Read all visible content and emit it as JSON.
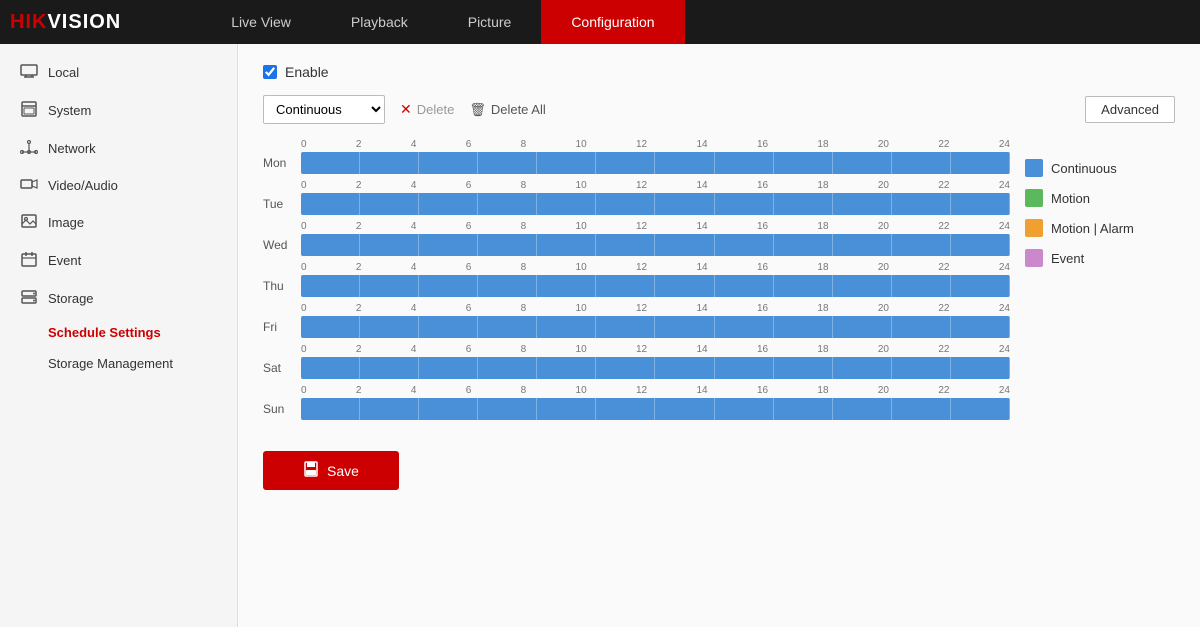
{
  "logo": {
    "brand": "HIKVISION",
    "brand_red": "HIK",
    "brand_white": "VISION"
  },
  "nav": {
    "items": [
      {
        "label": "Live View",
        "active": false
      },
      {
        "label": "Playback",
        "active": false
      },
      {
        "label": "Picture",
        "active": false
      },
      {
        "label": "Configuration",
        "active": true
      }
    ]
  },
  "sidebar": {
    "items": [
      {
        "label": "Local",
        "icon": "🖥",
        "active": false
      },
      {
        "label": "System",
        "icon": "⚙",
        "active": false
      },
      {
        "label": "Network",
        "icon": "🌐",
        "active": false
      },
      {
        "label": "Video/Audio",
        "icon": "🎤",
        "active": false
      },
      {
        "label": "Image",
        "icon": "🖼",
        "active": false
      },
      {
        "label": "Event",
        "icon": "📅",
        "active": false
      },
      {
        "label": "Storage",
        "icon": "💾",
        "active": false
      }
    ],
    "sub_items": [
      {
        "label": "Schedule Settings",
        "active": true
      },
      {
        "label": "Storage Management",
        "active": false
      }
    ]
  },
  "content": {
    "enable_label": "Enable",
    "type_options": [
      "Continuous",
      "Motion",
      "Motion | Alarm",
      "Event"
    ],
    "selected_type": "Continuous",
    "delete_label": "Delete",
    "delete_all_label": "Delete All",
    "advanced_label": "Advanced",
    "days": [
      "Mon",
      "Tue",
      "Wed",
      "Thu",
      "Fri",
      "Sat",
      "Sun"
    ],
    "time_marks": [
      "0",
      "2",
      "4",
      "6",
      "8",
      "10",
      "12",
      "14",
      "16",
      "18",
      "20",
      "22",
      "24"
    ],
    "legend": [
      {
        "label": "Continuous",
        "color": "#4a90d9"
      },
      {
        "label": "Motion",
        "color": "#5cb85c"
      },
      {
        "label": "Motion | Alarm",
        "color": "#f0a030"
      },
      {
        "label": "Event",
        "color": "#cc88cc"
      }
    ],
    "save_label": "Save"
  }
}
